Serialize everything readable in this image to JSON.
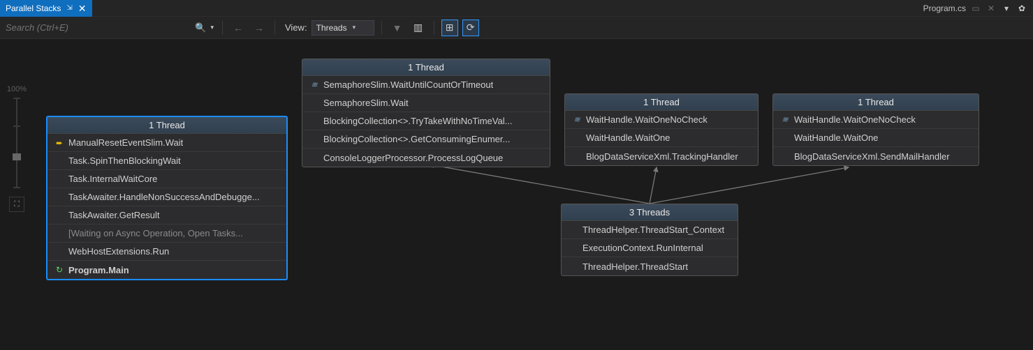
{
  "tab": {
    "title": "Parallel Stacks",
    "pin": "⇲",
    "close": "✕"
  },
  "right": {
    "filename": "Program.cs"
  },
  "toolbar": {
    "search_placeholder": "Search (Ctrl+E)",
    "view_label": "View:",
    "combo_value": "Threads"
  },
  "zoom": {
    "label": "100%"
  },
  "stacks": {
    "main": {
      "header": "1 Thread",
      "frames": [
        {
          "iconType": "yellow-arrow",
          "text": "ManualResetEventSlim.Wait"
        },
        {
          "text": "Task.SpinThenBlockingWait"
        },
        {
          "text": "Task.InternalWaitCore"
        },
        {
          "text": "TaskAwaiter.HandleNonSuccessAndDebugge..."
        },
        {
          "text": "TaskAwaiter.GetResult"
        },
        {
          "dim": true,
          "text": "[Waiting on Async Operation, Open Tasks..."
        },
        {
          "text": "WebHostExtensions.Run"
        },
        {
          "iconType": "green-arrow",
          "bold": true,
          "text": "Program.Main"
        }
      ]
    },
    "sem": {
      "header": "1 Thread",
      "frames": [
        {
          "iconType": "wave",
          "text": "SemaphoreSlim.WaitUntilCountOrTimeout"
        },
        {
          "text": "SemaphoreSlim.Wait"
        },
        {
          "text": "BlockingCollection<>.TryTakeWithNoTimeVal..."
        },
        {
          "text": "BlockingCollection<>.GetConsumingEnumer..."
        },
        {
          "text": "ConsoleLoggerProcessor.ProcessLogQueue"
        }
      ]
    },
    "wait1": {
      "header": "1 Thread",
      "frames": [
        {
          "iconType": "wave",
          "text": "WaitHandle.WaitOneNoCheck"
        },
        {
          "text": "WaitHandle.WaitOne"
        },
        {
          "text": "BlogDataServiceXml.TrackingHandler"
        }
      ]
    },
    "wait2": {
      "header": "1 Thread",
      "frames": [
        {
          "iconType": "wave",
          "text": "WaitHandle.WaitOneNoCheck"
        },
        {
          "text": "WaitHandle.WaitOne"
        },
        {
          "text": "BlogDataServiceXml.SendMailHandler"
        }
      ]
    },
    "threads3": {
      "header": "3 Threads",
      "frames": [
        {
          "text": "ThreadHelper.ThreadStart_Context"
        },
        {
          "text": "ExecutionContext.RunInternal"
        },
        {
          "text": "ThreadHelper.ThreadStart"
        }
      ]
    }
  }
}
